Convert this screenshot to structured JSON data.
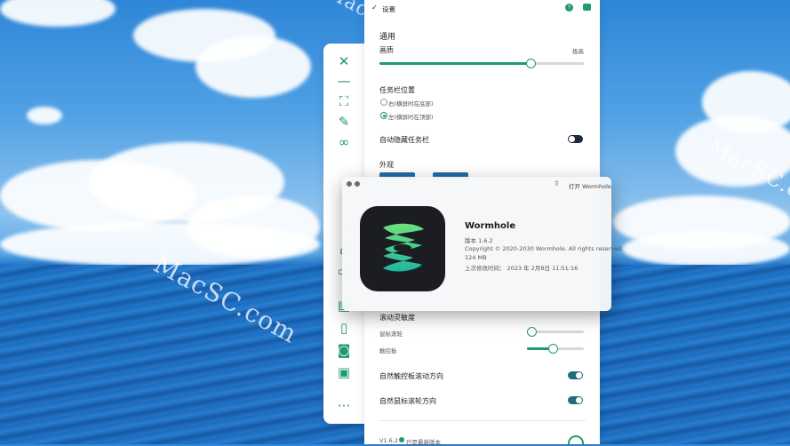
{
  "watermarks": [
    "MacSC.com",
    "MacSC.com",
    "MacSC.com"
  ],
  "colors": {
    "accent": "#1f9a6e",
    "toggle_off": "#1e2a3a",
    "toggle_on": "#1f6e7a"
  },
  "sidebar": {
    "icons": [
      "close-icon",
      "minimize-icon",
      "fullscreen-icon",
      "pin-icon",
      "connect-icon",
      "back-icon",
      "home-icon",
      "screen-icon",
      "document-icon",
      "file-icon",
      "camera-icon",
      "folder-icon",
      "more-icon"
    ]
  },
  "settings": {
    "title": "设置",
    "section_general": "通用",
    "quality_label": "画质",
    "quality_max_label": "极高",
    "quality_value": 0.72,
    "taskbar_position_label": "任务栏位置",
    "taskbar_options": [
      "右(横屏时在底部)",
      "左(横屏时在顶部)"
    ],
    "taskbar_selected": 1,
    "auto_hide_label": "自动隐藏任务栏",
    "auto_hide_on": false,
    "appearance_label": "外观",
    "scroll_sensitivity_label": "滚动灵敏度",
    "mouse_wheel_label": "鼠标滚轮",
    "mouse_wheel_value": 0.0,
    "trackpad_label": "触控板",
    "trackpad_value": 0.45,
    "natural_trackpad_label": "自然触控板滚动方向",
    "natural_trackpad_on": true,
    "natural_wheel_label": "自然鼠标滚轮方向",
    "natural_wheel_on": true,
    "footer_version": "V1.6.2",
    "footer_status": "已是最新版本"
  },
  "about": {
    "open_label": "打开 Wormhole",
    "app_name": "Wormhole",
    "version": "版本 1.6.2",
    "copyright": "Copyright © 2020-2030 Wormhole. All rights reserved.",
    "size": "124 MB",
    "modified": "上次修改时间： 2023 年 2月8日 11:51:16"
  }
}
